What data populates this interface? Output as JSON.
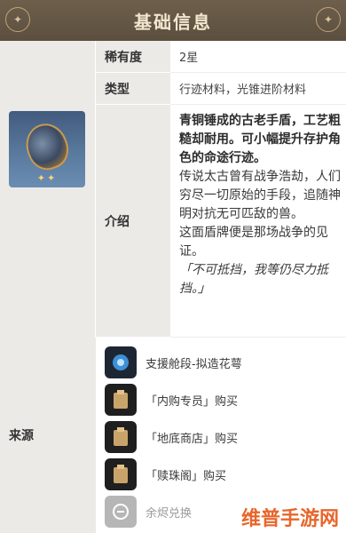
{
  "header": {
    "title": "基础信息"
  },
  "rows": {
    "rarity": {
      "label": "稀有度",
      "value": "2星"
    },
    "type": {
      "label": "类型",
      "value": "行迹材料，光锥进阶材料"
    },
    "intro": {
      "label": "介绍",
      "bold_text": "青铜锤成的古老手盾，工艺粗糙却耐用。可小幅提升存护角色的命途行迹。",
      "text1": "传说太古曾有战争浩劫，人们穷尽一切原始的手段，追随神明对抗无可匹敌的兽。",
      "text2": "这面盾牌便是那场战争的见证。",
      "quote": "「不可抵挡，我等仍尽力抵挡。」"
    }
  },
  "item_card": {
    "stars": "✦✦",
    "rarity_stars": 2
  },
  "source": {
    "label": "来源",
    "items": [
      {
        "label": "支援舱段-拟造花萼",
        "icon": "calyx-icon"
      },
      {
        "label": "「内购专员」购买",
        "icon": "shop-icon"
      },
      {
        "label": "「地底商店」购买",
        "icon": "shop-icon"
      },
      {
        "label": "「赎珠阁」购买",
        "icon": "shop-icon"
      },
      {
        "label": "余烬兑换",
        "icon": "exchange-icon"
      }
    ]
  },
  "watermark": "维普手游网",
  "colors": {
    "header_bg": "#5c4f3e",
    "header_text": "#f2e6cf",
    "label_bg": "#eceae7",
    "watermark": "#e8662b"
  }
}
